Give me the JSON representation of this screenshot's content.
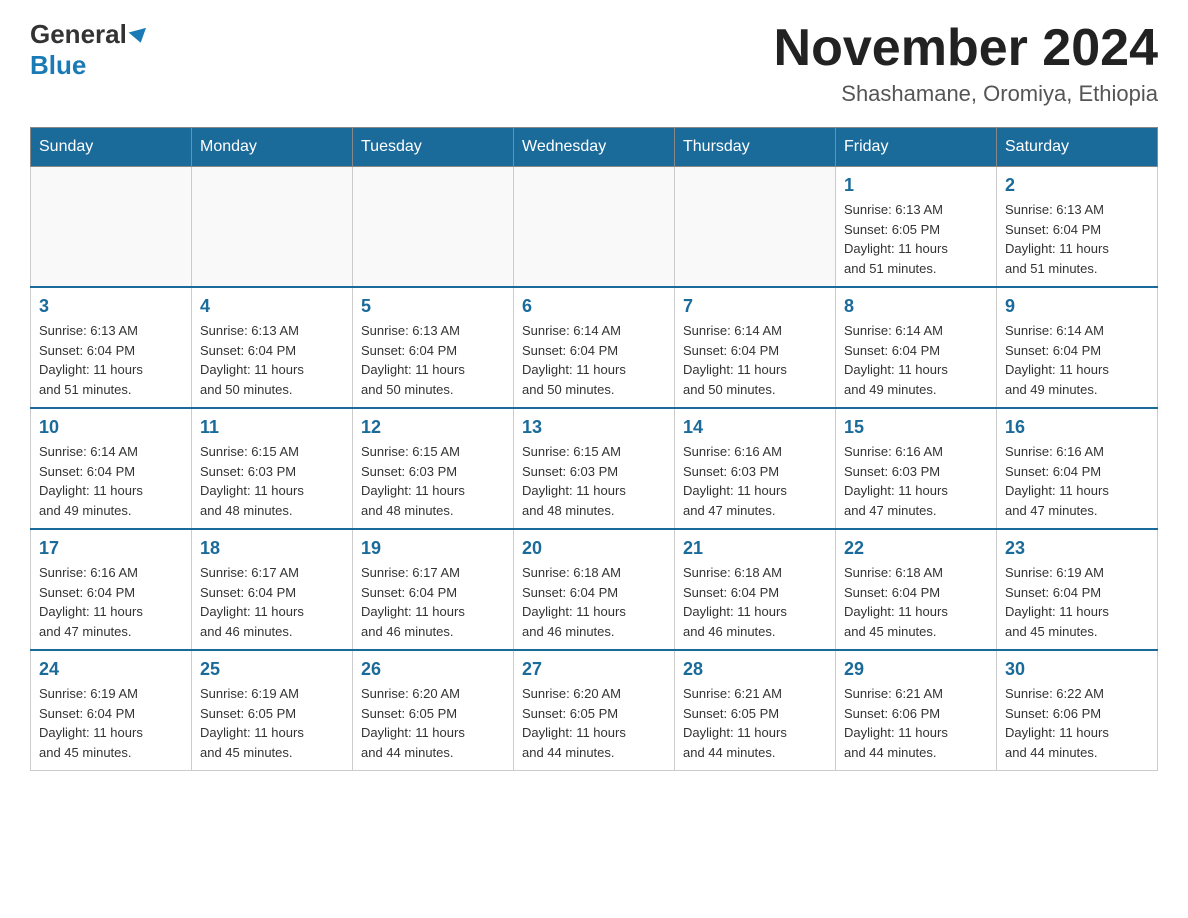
{
  "logo": {
    "line1": "General",
    "line2": "Blue"
  },
  "header": {
    "month_year": "November 2024",
    "location": "Shashamane, Oromiya, Ethiopia"
  },
  "weekdays": [
    "Sunday",
    "Monday",
    "Tuesday",
    "Wednesday",
    "Thursday",
    "Friday",
    "Saturday"
  ],
  "weeks": [
    [
      {
        "day": "",
        "info": ""
      },
      {
        "day": "",
        "info": ""
      },
      {
        "day": "",
        "info": ""
      },
      {
        "day": "",
        "info": ""
      },
      {
        "day": "",
        "info": ""
      },
      {
        "day": "1",
        "info": "Sunrise: 6:13 AM\nSunset: 6:05 PM\nDaylight: 11 hours\nand 51 minutes."
      },
      {
        "day": "2",
        "info": "Sunrise: 6:13 AM\nSunset: 6:04 PM\nDaylight: 11 hours\nand 51 minutes."
      }
    ],
    [
      {
        "day": "3",
        "info": "Sunrise: 6:13 AM\nSunset: 6:04 PM\nDaylight: 11 hours\nand 51 minutes."
      },
      {
        "day": "4",
        "info": "Sunrise: 6:13 AM\nSunset: 6:04 PM\nDaylight: 11 hours\nand 50 minutes."
      },
      {
        "day": "5",
        "info": "Sunrise: 6:13 AM\nSunset: 6:04 PM\nDaylight: 11 hours\nand 50 minutes."
      },
      {
        "day": "6",
        "info": "Sunrise: 6:14 AM\nSunset: 6:04 PM\nDaylight: 11 hours\nand 50 minutes."
      },
      {
        "day": "7",
        "info": "Sunrise: 6:14 AM\nSunset: 6:04 PM\nDaylight: 11 hours\nand 50 minutes."
      },
      {
        "day": "8",
        "info": "Sunrise: 6:14 AM\nSunset: 6:04 PM\nDaylight: 11 hours\nand 49 minutes."
      },
      {
        "day": "9",
        "info": "Sunrise: 6:14 AM\nSunset: 6:04 PM\nDaylight: 11 hours\nand 49 minutes."
      }
    ],
    [
      {
        "day": "10",
        "info": "Sunrise: 6:14 AM\nSunset: 6:04 PM\nDaylight: 11 hours\nand 49 minutes."
      },
      {
        "day": "11",
        "info": "Sunrise: 6:15 AM\nSunset: 6:03 PM\nDaylight: 11 hours\nand 48 minutes."
      },
      {
        "day": "12",
        "info": "Sunrise: 6:15 AM\nSunset: 6:03 PM\nDaylight: 11 hours\nand 48 minutes."
      },
      {
        "day": "13",
        "info": "Sunrise: 6:15 AM\nSunset: 6:03 PM\nDaylight: 11 hours\nand 48 minutes."
      },
      {
        "day": "14",
        "info": "Sunrise: 6:16 AM\nSunset: 6:03 PM\nDaylight: 11 hours\nand 47 minutes."
      },
      {
        "day": "15",
        "info": "Sunrise: 6:16 AM\nSunset: 6:03 PM\nDaylight: 11 hours\nand 47 minutes."
      },
      {
        "day": "16",
        "info": "Sunrise: 6:16 AM\nSunset: 6:04 PM\nDaylight: 11 hours\nand 47 minutes."
      }
    ],
    [
      {
        "day": "17",
        "info": "Sunrise: 6:16 AM\nSunset: 6:04 PM\nDaylight: 11 hours\nand 47 minutes."
      },
      {
        "day": "18",
        "info": "Sunrise: 6:17 AM\nSunset: 6:04 PM\nDaylight: 11 hours\nand 46 minutes."
      },
      {
        "day": "19",
        "info": "Sunrise: 6:17 AM\nSunset: 6:04 PM\nDaylight: 11 hours\nand 46 minutes."
      },
      {
        "day": "20",
        "info": "Sunrise: 6:18 AM\nSunset: 6:04 PM\nDaylight: 11 hours\nand 46 minutes."
      },
      {
        "day": "21",
        "info": "Sunrise: 6:18 AM\nSunset: 6:04 PM\nDaylight: 11 hours\nand 46 minutes."
      },
      {
        "day": "22",
        "info": "Sunrise: 6:18 AM\nSunset: 6:04 PM\nDaylight: 11 hours\nand 45 minutes."
      },
      {
        "day": "23",
        "info": "Sunrise: 6:19 AM\nSunset: 6:04 PM\nDaylight: 11 hours\nand 45 minutes."
      }
    ],
    [
      {
        "day": "24",
        "info": "Sunrise: 6:19 AM\nSunset: 6:04 PM\nDaylight: 11 hours\nand 45 minutes."
      },
      {
        "day": "25",
        "info": "Sunrise: 6:19 AM\nSunset: 6:05 PM\nDaylight: 11 hours\nand 45 minutes."
      },
      {
        "day": "26",
        "info": "Sunrise: 6:20 AM\nSunset: 6:05 PM\nDaylight: 11 hours\nand 44 minutes."
      },
      {
        "day": "27",
        "info": "Sunrise: 6:20 AM\nSunset: 6:05 PM\nDaylight: 11 hours\nand 44 minutes."
      },
      {
        "day": "28",
        "info": "Sunrise: 6:21 AM\nSunset: 6:05 PM\nDaylight: 11 hours\nand 44 minutes."
      },
      {
        "day": "29",
        "info": "Sunrise: 6:21 AM\nSunset: 6:06 PM\nDaylight: 11 hours\nand 44 minutes."
      },
      {
        "day": "30",
        "info": "Sunrise: 6:22 AM\nSunset: 6:06 PM\nDaylight: 11 hours\nand 44 minutes."
      }
    ]
  ]
}
